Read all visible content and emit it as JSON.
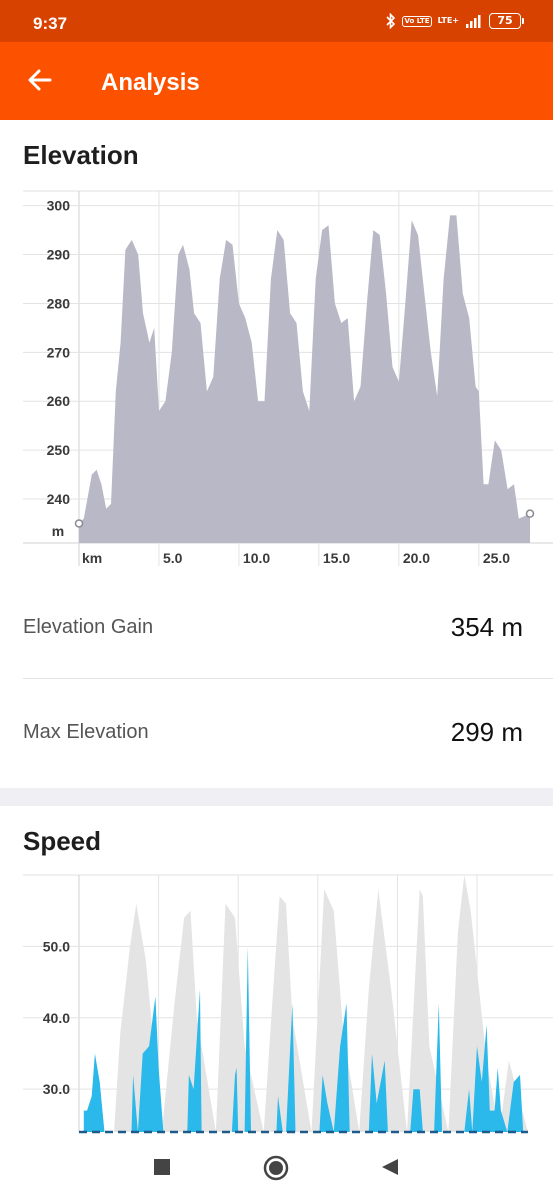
{
  "status_bar": {
    "time": "9:37",
    "icons": [
      "bluetooth-icon",
      "volte-icon",
      "lte-signal-icon",
      "battery-icon"
    ],
    "volte_text": "Vo LTE",
    "lte_text": "LTE+",
    "battery_level": "75"
  },
  "app_bar": {
    "title": "Analysis",
    "back_icon": "arrow-left-icon"
  },
  "elevation": {
    "title": "Elevation",
    "chart_data": {
      "type": "area",
      "xlabel": "km",
      "ylabel": "m",
      "x_ticks": [
        "5.0",
        "10.0",
        "15.0",
        "20.0",
        "25.0"
      ],
      "y_ticks": [
        "300",
        "290",
        "280",
        "270",
        "260",
        "250",
        "240"
      ],
      "xlim": [
        0,
        28.2
      ],
      "ylim": [
        231,
        303
      ],
      "grid": true,
      "fill_color": "#b9b8c6",
      "x": [
        0,
        0.3,
        0.8,
        1.1,
        1.4,
        1.7,
        2.0,
        2.3,
        2.6,
        2.9,
        3.3,
        3.7,
        4.0,
        4.4,
        4.7,
        5.0,
        5.4,
        5.8,
        6.2,
        6.5,
        6.9,
        7.2,
        7.6,
        8.0,
        8.4,
        8.8,
        9.2,
        9.6,
        10.0,
        10.4,
        10.8,
        11.2,
        11.6,
        12.0,
        12.4,
        12.8,
        13.2,
        13.6,
        14.0,
        14.4,
        14.8,
        15.2,
        15.6,
        16.0,
        16.4,
        16.8,
        17.2,
        17.6,
        18.0,
        18.4,
        18.8,
        19.2,
        19.6,
        20.0,
        20.4,
        20.8,
        21.2,
        21.6,
        22.0,
        22.4,
        22.8,
        23.2,
        23.6,
        24.0,
        24.4,
        24.8,
        25.0,
        25.3,
        25.6,
        26.0,
        26.4,
        26.8,
        27.2,
        27.5,
        28.2
      ],
      "values": [
        235,
        236,
        245,
        246,
        243,
        238,
        239,
        262,
        272,
        291,
        293,
        290,
        278,
        272,
        275,
        258,
        260,
        270,
        290,
        292,
        287,
        278,
        276,
        262,
        265,
        285,
        293,
        292,
        280,
        277,
        272,
        260,
        260,
        285,
        295,
        293,
        278,
        276,
        262,
        258,
        285,
        295,
        296,
        280,
        276,
        277,
        260,
        263,
        280,
        295,
        294,
        282,
        267,
        264,
        280,
        297,
        294,
        282,
        270,
        261,
        285,
        298,
        298,
        282,
        277,
        263,
        262,
        243,
        243,
        252,
        250,
        242,
        243,
        236,
        237
      ]
    }
  },
  "stats": [
    {
      "label": "Elevation Gain",
      "value": "354 m"
    },
    {
      "label": "Max Elevation",
      "value": "299 m"
    }
  ],
  "speed": {
    "title": "Speed",
    "chart_data": {
      "type": "area",
      "y_ticks": [
        "50.0",
        "40.0",
        "30.0"
      ],
      "xlim": [
        0,
        28.2
      ],
      "ylim": [
        24,
        60
      ],
      "grid": true,
      "series": [
        {
          "color": "#e4e4e4",
          "x": [
            0,
            2.2,
            2.6,
            3.2,
            3.6,
            4.2,
            5.2,
            6.0,
            6.6,
            7.0,
            7.4,
            8.6,
            9.2,
            9.8,
            10.4,
            11.6,
            12.2,
            12.6,
            13.0,
            13.4,
            14.6,
            15.4,
            16.0,
            16.6,
            17.6,
            18.2,
            18.8,
            19.6,
            20.6,
            21.4,
            21.6,
            22.0,
            23.2,
            23.8,
            24.2,
            24.6,
            25.6,
            26.4,
            27.0,
            28.2
          ],
          "values": [
            24,
            24,
            38,
            50,
            56,
            48,
            24,
            42,
            54,
            55,
            40,
            24,
            56,
            54,
            36,
            24,
            44,
            57,
            56,
            40,
            24,
            58,
            55,
            38,
            24,
            44,
            58,
            44,
            24,
            58,
            57,
            36,
            24,
            52,
            60,
            55,
            34,
            24,
            34,
            24
          ]
        },
        {
          "color": "#2bb8ea",
          "x": [
            0.3,
            0.5,
            0.8,
            1.0,
            1.3,
            1.6,
            1.8,
            2.0,
            3.3,
            3.4,
            3.7,
            4.0,
            4.4,
            4.8,
            5.0,
            5.3,
            5.5,
            6.8,
            6.9,
            7.2,
            7.6,
            7.7,
            8.0,
            9.6,
            9.8,
            9.9,
            10.0,
            10.4,
            10.6,
            10.8,
            11.2,
            12.4,
            12.5,
            12.8,
            13.0,
            13.4,
            13.6,
            15.1,
            15.3,
            15.6,
            16.0,
            16.4,
            16.8,
            17.0,
            18.2,
            18.4,
            18.7,
            19.2,
            19.4,
            19.7,
            20.8,
            21.0,
            21.4,
            21.6,
            22.3,
            22.6,
            22.8,
            24.2,
            24.5,
            24.7,
            25.0,
            25.3,
            25.6,
            25.8,
            26.1,
            26.3,
            26.5,
            26.9,
            27.3,
            27.7,
            27.9
          ],
          "values": [
            27,
            27,
            29,
            35,
            31,
            24,
            24,
            24,
            24,
            32,
            24,
            35,
            36,
            43,
            33,
            24,
            24,
            24,
            32,
            30,
            44,
            24,
            24,
            24,
            32,
            33,
            24,
            24,
            50,
            24,
            24,
            24,
            29,
            24,
            24,
            42,
            24,
            24,
            32,
            28,
            24,
            36,
            42,
            24,
            24,
            35,
            28,
            34,
            24,
            24,
            24,
            30,
            30,
            24,
            24,
            42,
            24,
            24,
            30,
            24,
            36,
            31,
            39,
            27,
            27,
            33,
            27,
            24,
            31,
            32,
            24
          ]
        }
      ]
    }
  },
  "nav_bar": {
    "icons": [
      "recent-apps-icon",
      "home-icon",
      "back-icon"
    ]
  }
}
